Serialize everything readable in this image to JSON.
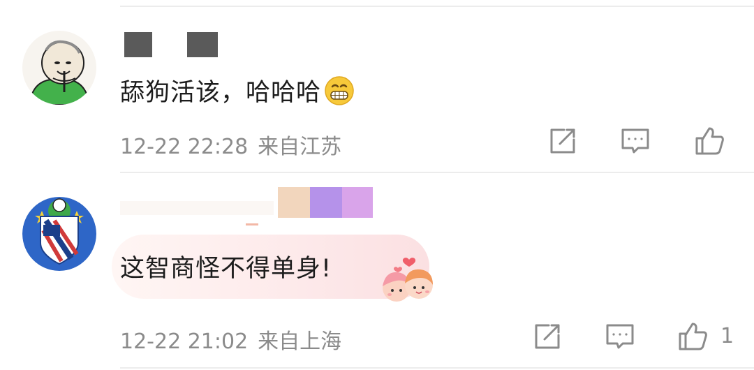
{
  "comments": [
    {
      "text": "舔狗活该，哈哈哈",
      "emoji": "grin-emoji",
      "date": "12-22 22:28",
      "location": "来自江苏",
      "like_count": ""
    },
    {
      "text": "这智商怪不得单身!",
      "emoji": "couple-sticker",
      "date": "12-22 21:02",
      "location": "来自上海",
      "like_count": "1"
    }
  ],
  "icons": {
    "share": "share-icon",
    "reply": "comment-icon",
    "like": "thumbs-up-icon"
  },
  "colors": {
    "meta_text": "#8b8b8b",
    "redaction": "#5a5a5a",
    "swatch_peach": "#f2d6bd",
    "swatch_purple": "#b592ea",
    "swatch_lilac": "#d9a4ea"
  }
}
